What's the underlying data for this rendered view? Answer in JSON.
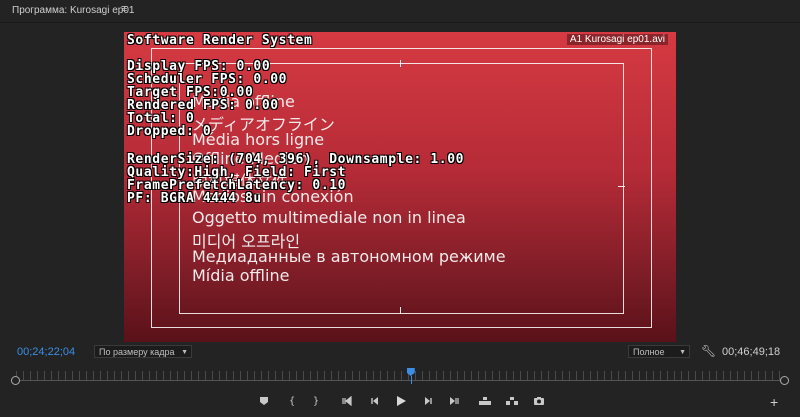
{
  "panel": {
    "title": "Программа: Kurosagi ep01",
    "menu_icon": "hamburger-icon"
  },
  "monitor": {
    "clip_name": "A1 Kurosagi ep01.avi",
    "offline_lines": [
      "Media offline",
      "メディアオフライン",
      "Média hors ligne",
      "Offline-Medien",
      "脱机媒体文件",
      "Medios sin conexión",
      "Oggetto multimediale non in linea",
      "미디어 오프라인",
      "Медиаданные в автономном режиме",
      "Mídia offline"
    ],
    "debug": {
      "header": "Software Render System",
      "lines": [
        "Display FPS: 0.00",
        "Scheduler FPS: 0.00",
        "Target FPS:0.00",
        "Rendered FPS: 0.00",
        "Total: 0",
        "Dropped: 0",
        "RenderSize: (704, 396), Downsample: 1.00",
        "Quality:High, Field: First",
        "FramePrefetchLatency: 0.10",
        "PF: BGRA 4444 8u"
      ]
    }
  },
  "controls": {
    "current_timecode": "00;24;22;04",
    "duration_timecode": "00;46;49;18",
    "zoom_select": "По размеру кадра",
    "quality_select": "Полное",
    "settings_icon": "wrench-icon",
    "playhead_position": 0.514,
    "buttons": [
      {
        "name": "add-marker-button",
        "icon": "marker-icon"
      },
      {
        "name": "mark-in-button",
        "icon": "mark-in-icon"
      },
      {
        "name": "mark-out-button",
        "icon": "mark-out-icon"
      },
      {
        "name": "go-to-in-button",
        "icon": "go-to-in-icon"
      },
      {
        "name": "step-back-button",
        "icon": "step-back-icon"
      },
      {
        "name": "play-button",
        "icon": "play-icon"
      },
      {
        "name": "step-forward-button",
        "icon": "step-forward-icon"
      },
      {
        "name": "go-to-out-button",
        "icon": "go-to-out-icon"
      },
      {
        "name": "lift-button",
        "icon": "lift-icon"
      },
      {
        "name": "extract-button",
        "icon": "extract-icon"
      },
      {
        "name": "export-frame-button",
        "icon": "camera-icon"
      },
      {
        "name": "button-editor-button",
        "icon": "plus-icon"
      }
    ]
  }
}
